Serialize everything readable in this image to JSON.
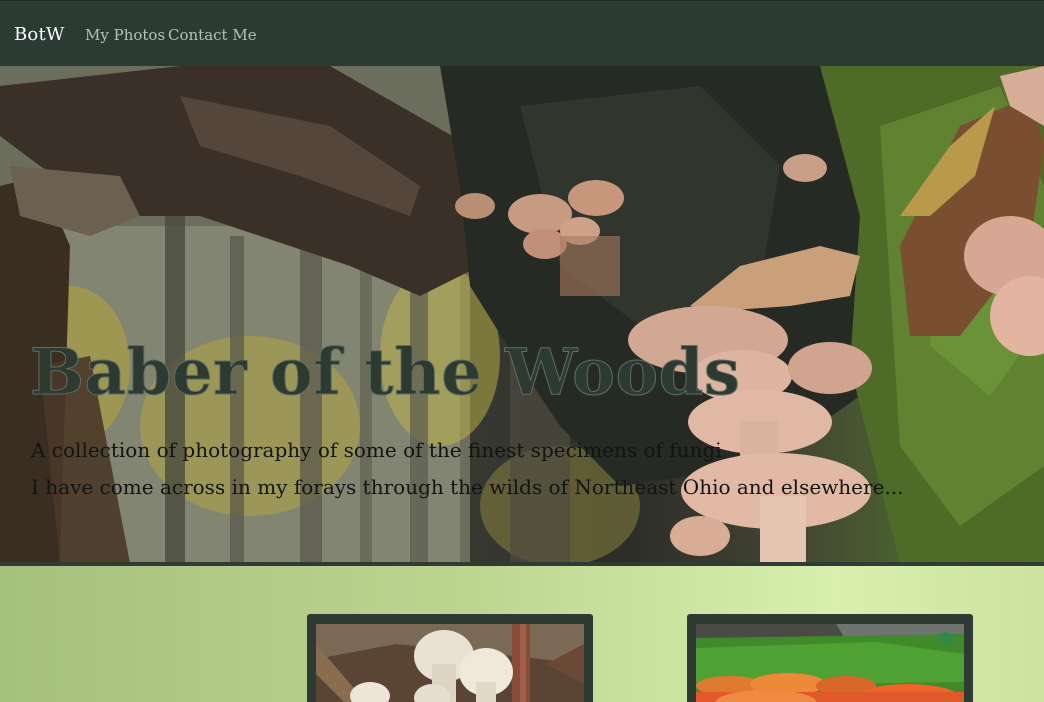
{
  "nav": {
    "brand": "BotW",
    "links": [
      {
        "label": "My Photos"
      },
      {
        "label": "Contact Me"
      }
    ]
  },
  "hero": {
    "title": "Baber of the Woods",
    "subtitle_line1": "A collection of photography of some of the finest specimens of fungi",
    "subtitle_line2": "I have come across in my forays through the wilds of Northeast Ohio and elsewhere..."
  },
  "colors": {
    "navbar": "#2b3a33",
    "gallery_left": "#a6c07d",
    "gallery_right": "#d8efad",
    "card_frame": "#2f3a35",
    "title_text": "#2c3a32"
  },
  "gallery": {
    "cards": [
      {
        "image": "white-puffball-mushrooms"
      },
      {
        "image": "orange-bracket-fungi-on-moss"
      }
    ]
  }
}
